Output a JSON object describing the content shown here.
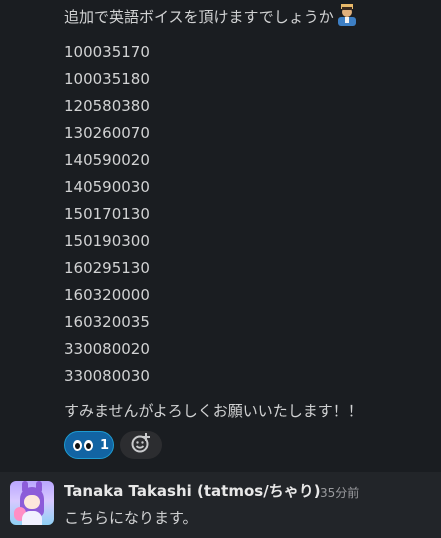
{
  "message": {
    "request_text": "追加で英語ボイスを頂けますでしょうか",
    "request_emoji": "person-bowing-emoji",
    "ids": [
      "100035170",
      "100035180",
      "120580380",
      "130260070",
      "140590020",
      "140590030",
      "150170130",
      "150190300",
      "160295130",
      "160320000",
      "160320035",
      "330080020",
      "330080030"
    ],
    "closing_text": "すみませんがよろしくお願いいたします！！",
    "reactions": [
      {
        "emoji": "eyes-emoji",
        "count": "1",
        "active": true
      }
    ],
    "add_reaction_icon": "add-reaction-icon"
  },
  "reply": {
    "sender": "Tanaka Takashi (tatmos/ちゃり)",
    "time": "35分前",
    "text": "こちらになります。"
  },
  "colors": {
    "background": "#1a1d21",
    "reply_background": "#222529",
    "reaction_active": "#1264a3",
    "text": "#d1d2d3"
  }
}
